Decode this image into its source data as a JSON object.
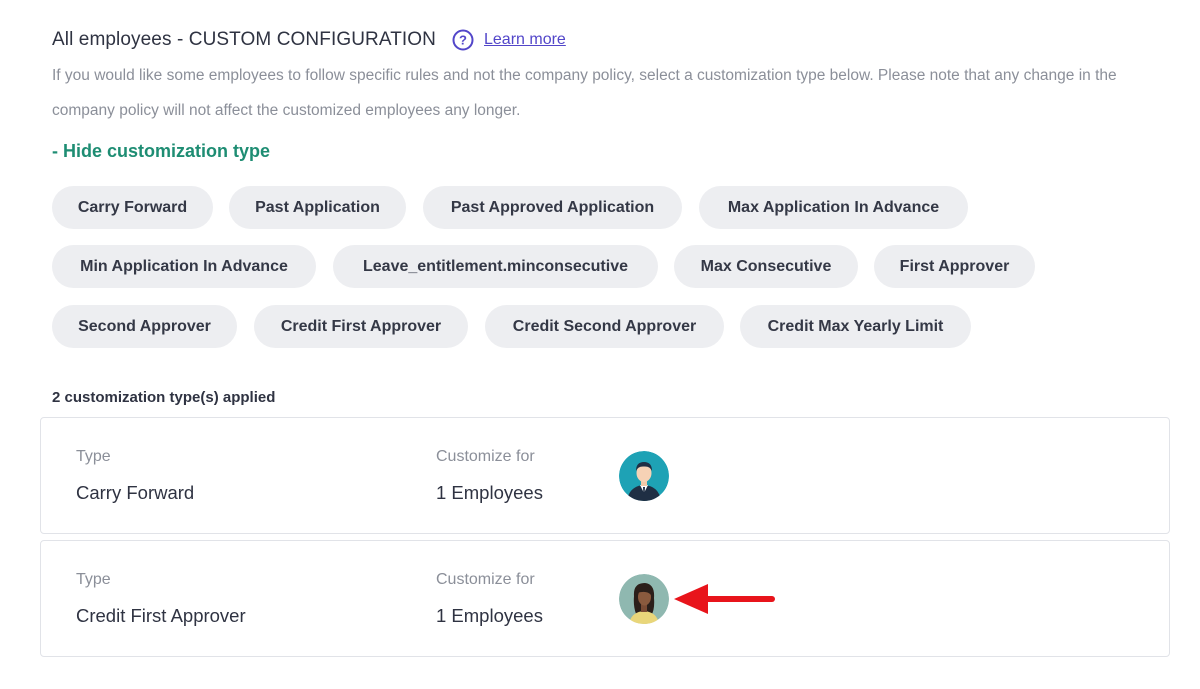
{
  "header": {
    "title": "All employees - CUSTOM CONFIGURATION",
    "learn_more": "Learn more",
    "help_icon": "question-circle-icon"
  },
  "description": "If you would like some employees to follow specific rules and not the company policy, select a customization type below. Please note that any change in the company policy will not affect the customized employees any longer.",
  "toggle_label": "- Hide customization type",
  "customization_types": [
    "Carry Forward",
    "Past Application",
    "Past Approved Application",
    "Max Application In Advance",
    "Min Application In Advance",
    "Leave_entitlement.minconsecutive",
    "Max Consecutive",
    "First Approver",
    "Second Approver",
    "Credit First Approver",
    "Credit Second Approver",
    "Credit Max Yearly Limit"
  ],
  "applied_count_text": "2 customization type(s) applied",
  "applied": [
    {
      "type_label": "Type",
      "type_value": "Carry Forward",
      "customize_label": "Customize for",
      "customize_value": "1 Employees",
      "avatar": "male-employee-avatar"
    },
    {
      "type_label": "Type",
      "type_value": "Credit First Approver",
      "customize_label": "Customize for",
      "customize_value": "1 Employees",
      "avatar": "female-employee-avatar"
    }
  ],
  "colors": {
    "accent": "#5246c9",
    "toggle": "#1e8d73",
    "chip_bg": "#edeef1",
    "annotation_arrow": "#e8141b"
  }
}
